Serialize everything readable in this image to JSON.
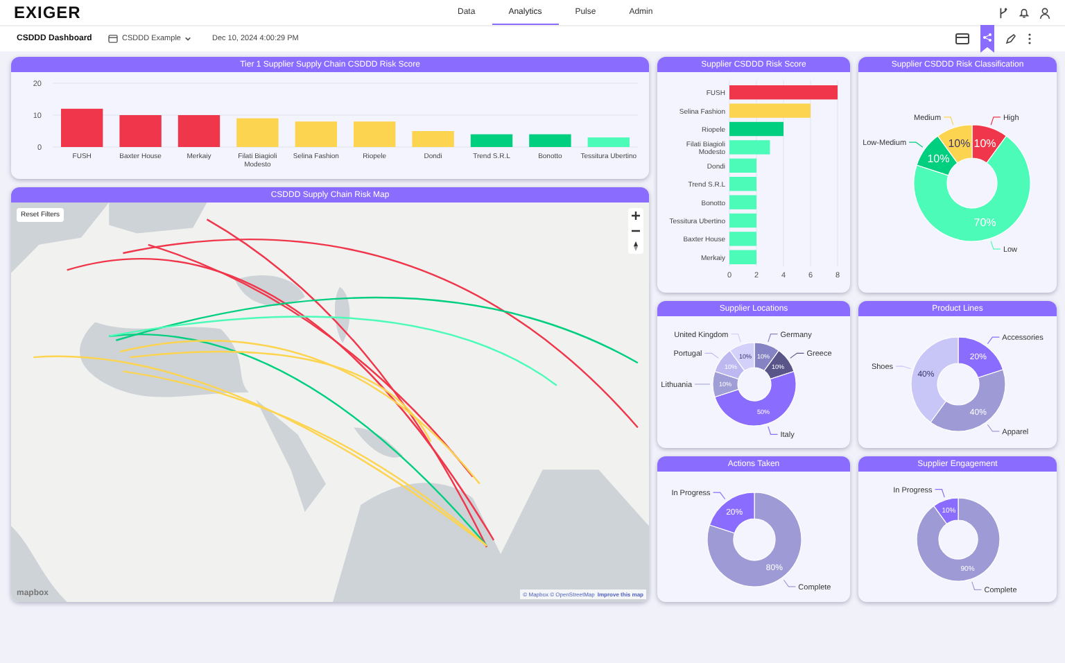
{
  "header": {
    "logo": "EXIGER",
    "nav": [
      {
        "label": "Data",
        "selected": false
      },
      {
        "label": "Analytics",
        "selected": true
      },
      {
        "label": "Pulse",
        "selected": false
      },
      {
        "label": "Admin",
        "selected": false
      }
    ]
  },
  "toolbar": {
    "title": "CSDDD Dashboard",
    "dataset": "CSDDD Example",
    "timestamp": "Dec 10, 2024 4:00:29 PM"
  },
  "tier1_chart": {
    "title": "Tier 1 Supplier Supply Chain CSDDD Risk Score",
    "chart_data": {
      "type": "bar",
      "categories": [
        "FUSH",
        "Baxter House",
        "Merkaiy",
        "Filati Biagioli Modesto",
        "Selina Fashion",
        "Riopele",
        "Dondi",
        "Trend S.R.L",
        "Bonotto",
        "Tessitura Ubertino"
      ],
      "stacked": true,
      "grid": true,
      "ylim": [
        0,
        20
      ],
      "yticks": [
        0,
        10,
        20
      ],
      "series": [
        {
          "color": "#f0364a",
          "values": [
            12,
            10,
            10,
            null,
            null,
            null,
            null,
            null,
            null,
            null
          ]
        },
        {
          "color": "#fdd44f",
          "values": [
            null,
            null,
            null,
            9,
            8,
            8,
            5,
            null,
            null,
            null
          ]
        },
        {
          "color": "#00cf7f",
          "values": [
            null,
            null,
            null,
            null,
            null,
            null,
            null,
            4,
            4,
            null
          ]
        },
        {
          "color": "#4dfbb8",
          "values": [
            null,
            null,
            null,
            null,
            null,
            null,
            null,
            null,
            null,
            3
          ]
        }
      ]
    }
  },
  "supplier_score": {
    "title": "Supplier CSDDD Risk Score",
    "chart_data": {
      "type": "bar",
      "orientation": "horizontal",
      "categories": [
        "FUSH",
        "Selina Fashion",
        "Riopele",
        "Filati Biagioli Modesto",
        "Dondi",
        "Trend S.R.L",
        "Bonotto",
        "Tessitura Ubertino",
        "Baxter House",
        "Merkaiy"
      ],
      "stacked": true,
      "grid": true,
      "xlim": [
        0,
        8
      ],
      "xticks": [
        0,
        2,
        4,
        6,
        8
      ],
      "series": [
        {
          "color": "#f0364a",
          "values": [
            8,
            null,
            null,
            null,
            null,
            null,
            null,
            null,
            null,
            null
          ]
        },
        {
          "color": "#fdd44f",
          "values": [
            null,
            6,
            null,
            null,
            null,
            null,
            null,
            null,
            null,
            null
          ]
        },
        {
          "color": "#00cf7f",
          "values": [
            null,
            null,
            4,
            null,
            null,
            null,
            null,
            null,
            null,
            null
          ]
        },
        {
          "color": "#4dfbb8",
          "values": [
            null,
            null,
            null,
            3,
            2,
            2,
            2,
            2,
            2,
            2
          ]
        }
      ]
    }
  },
  "risk_classification": {
    "title": "Supplier CSDDD Risk Classification",
    "chart_data": {
      "type": "donut",
      "categories": [
        "High",
        "Low",
        "Low-Medium",
        "Medium"
      ],
      "values": [
        10,
        70,
        10,
        10
      ],
      "value_labels": [
        "10%",
        "70%",
        "10%",
        "10%"
      ]
    }
  },
  "map": {
    "title": "CSDDD Supply Chain Risk Map",
    "reset_button": "Reset Filters",
    "logo": "mapbox",
    "attribution": "© Mapbox © OpenStreetMap",
    "improve_link": "Improve this map"
  },
  "locations": {
    "title": "Supplier Locations",
    "chart_data": {
      "type": "donut",
      "categories": [
        "Germany",
        "Greece",
        "Italy",
        "Lithuania",
        "Portugal",
        "United Kingdom"
      ],
      "values": [
        10,
        10,
        50,
        10,
        10,
        10
      ],
      "value_labels": [
        "10%",
        "10%",
        "50%",
        "10%",
        "10%",
        "10%"
      ]
    }
  },
  "product_lines": {
    "title": "Product Lines",
    "chart_data": {
      "type": "donut",
      "categories": [
        "Accessories",
        "Apparel",
        "Shoes"
      ],
      "values": [
        20,
        40,
        40
      ],
      "value_labels": [
        "20%",
        "40%",
        "40%"
      ]
    }
  },
  "actions": {
    "title": "Actions Taken",
    "chart_data": {
      "type": "donut",
      "categories": [
        "Complete",
        "In Progress"
      ],
      "values": [
        80,
        20
      ],
      "value_labels": [
        "80%",
        "20%"
      ]
    }
  },
  "engagement": {
    "title": "Supplier Engagement",
    "chart_data": {
      "type": "donut",
      "categories": [
        "Complete",
        "In Progress"
      ],
      "values": [
        90,
        10
      ],
      "value_labels": [
        "90%",
        "10%"
      ]
    }
  }
}
